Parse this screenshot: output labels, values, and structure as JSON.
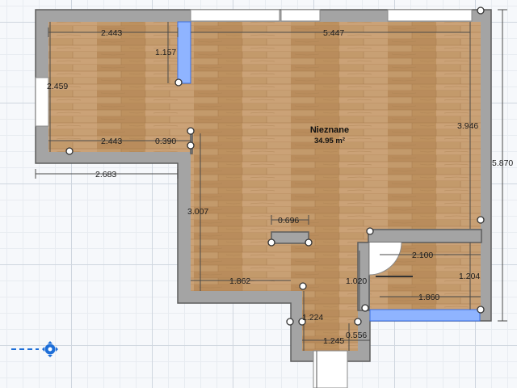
{
  "room": {
    "name": "Nieznane",
    "area": "34.95 m²"
  },
  "dimensions": {
    "top_left_width": "2.443",
    "top_right_width": "5.447",
    "left_height": "2.459",
    "niche_height": "1.157",
    "inner_left_width": "2.443",
    "small_segment": "0.390",
    "outer_left_width": "2.683",
    "right_height": "3.946",
    "total_height": "5.870",
    "mid_height": "3.007",
    "counter_width": "0.696",
    "bottom_left_width": "1.862",
    "closet_width": "2.100",
    "closet_height": "1.204",
    "door_gap": "1.020",
    "closet_bottom_width": "1.860",
    "entry_height": "1.224",
    "entry_width": "1.245",
    "entry_side": "0.556"
  },
  "colors": {
    "wall": "#a4a4a4",
    "floor_wood": "#c49a6c",
    "window_highlight": "#8fb4ff",
    "grid": "#cfd6df"
  },
  "icons": {
    "compass": "compass-icon"
  }
}
